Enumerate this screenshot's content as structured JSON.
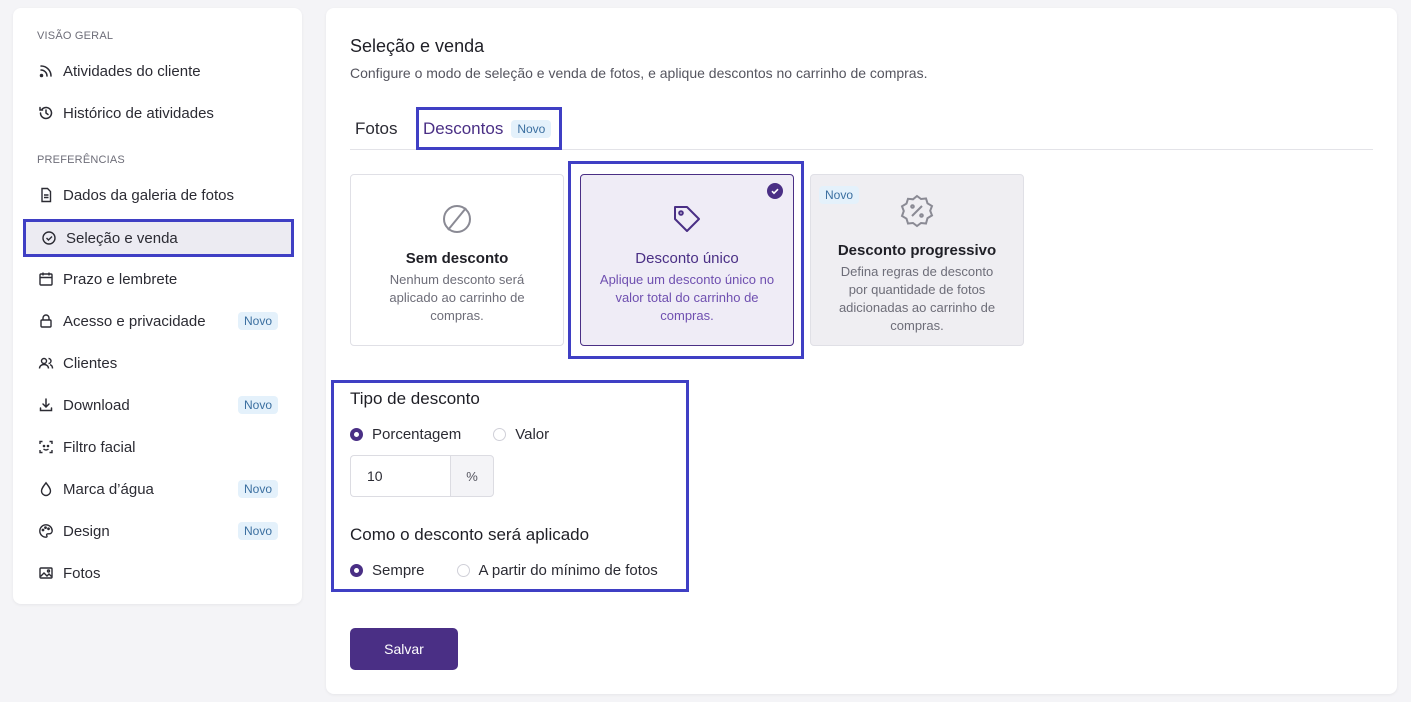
{
  "sidebar": {
    "section_overview": "VISÃO GERAL",
    "section_prefs": "PREFERÊNCIAS",
    "items": [
      {
        "label": "Atividades do cliente",
        "icon": "rss-icon"
      },
      {
        "label": "Histórico de atividades",
        "icon": "history-icon"
      },
      {
        "label": "Dados da galeria de fotos",
        "icon": "document-icon"
      },
      {
        "label": "Seleção e venda",
        "icon": "badge-check-icon"
      },
      {
        "label": "Prazo e lembrete",
        "icon": "calendar-icon"
      },
      {
        "label": "Acesso e privacidade",
        "icon": "lock-icon",
        "badge": "Novo"
      },
      {
        "label": "Clientes",
        "icon": "users-icon"
      },
      {
        "label": "Download",
        "icon": "download-icon",
        "badge": "Novo"
      },
      {
        "label": "Filtro facial",
        "icon": "face-scan-icon"
      },
      {
        "label": "Marca d’água",
        "icon": "drop-icon",
        "badge": "Novo"
      },
      {
        "label": "Design",
        "icon": "palette-icon",
        "badge": "Novo"
      },
      {
        "label": "Fotos",
        "icon": "image-icon"
      }
    ]
  },
  "main": {
    "title": "Seleção e venda",
    "subtitle": "Configure o modo de seleção e venda de fotos, e aplique descontos no carrinho de compras.",
    "tabs": [
      {
        "label": "Fotos"
      },
      {
        "label": "Descontos",
        "badge": "Novo"
      }
    ],
    "cards": [
      {
        "title": "Sem desconto",
        "desc": "Nenhum desconto será aplicado ao carrinho de compras."
      },
      {
        "title": "Desconto único",
        "desc": "Aplique um desconto único no valor total do carrinho de compras.",
        "selected": true
      },
      {
        "title": "Desconto progressivo",
        "desc": "Defina regras de desconto por quantidade de fotos adicionadas ao carrinho de compras.",
        "badge": "Novo"
      }
    ],
    "discount_type": {
      "title": "Tipo de desconto",
      "options": [
        "Porcentagem",
        "Valor"
      ],
      "selected": "Porcentagem",
      "value": "10",
      "suffix": "%"
    },
    "apply_mode": {
      "title": "Como o desconto será aplicado",
      "options": [
        "Sempre",
        "A partir do mínimo de fotos"
      ],
      "selected": "Sempre"
    },
    "save_label": "Salvar"
  },
  "colors": {
    "accent": "#4a2f85",
    "highlight": "#3f3fc4",
    "badge_bg": "#e4f1fb"
  }
}
